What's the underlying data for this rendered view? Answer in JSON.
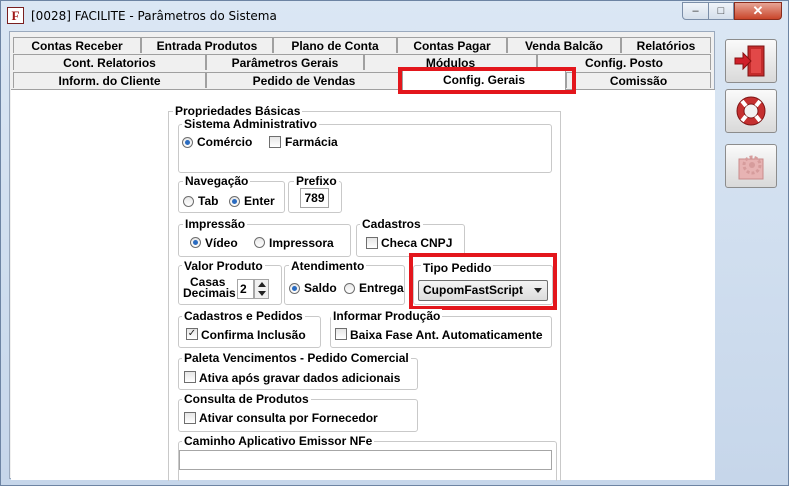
{
  "window": {
    "title": "[0028] FACILITE - Parâmetros do Sistema",
    "app_icon_letter": "F",
    "minimize": "–",
    "maximize": "□",
    "close": "✕"
  },
  "tabs": {
    "row1": [
      "Contas Receber",
      "Entrada Produtos",
      "Plano de Conta",
      "Contas Pagar",
      "Venda Balcão",
      "Relatórios"
    ],
    "row2": [
      "Cont. Relatorios",
      "Parâmetros Gerais",
      "Módulos",
      "Config. Posto"
    ],
    "row3": [
      "Inform. do Cliente",
      "Pedido de Vendas",
      "Config. Gerais",
      "Comissão"
    ],
    "active": "Config. Gerais"
  },
  "form": {
    "propriedades_basicas": "Propriedades Básicas",
    "sistema_administrativo": {
      "label": "Sistema Administrativo",
      "comercio": "Comércio",
      "farmacia": "Farmácia",
      "selected": "Comércio"
    },
    "navegacao": {
      "label": "Navegação",
      "tab": "Tab",
      "enter": "Enter",
      "selected": "Enter"
    },
    "prefixo": {
      "label": "Prefixo",
      "value": "789"
    },
    "impressao": {
      "label": "Impressão",
      "video": "Vídeo",
      "impressora": "Impressora",
      "selected": "Vídeo"
    },
    "cadastros": {
      "label": "Cadastros",
      "checa_cnpj": "Checa CNPJ",
      "checa_cnpj_checked": false
    },
    "valor_produto": {
      "label": "Valor Produto",
      "casas": "Casas",
      "decimais": "Decimais",
      "value": "2"
    },
    "atendimento": {
      "label": "Atendimento",
      "saldo": "Saldo",
      "entrega": "Entrega",
      "selected": "Saldo"
    },
    "tipo_pedido": {
      "label": "Tipo Pedido",
      "value": "CupomFastScript"
    },
    "cadastros_pedidos": {
      "label": "Cadastros e Pedidos",
      "confirma_inclusao": "Confirma Inclusão",
      "checked": true
    },
    "informar_producao": {
      "label": "Informar Produção",
      "baixa_fase": "Baixa Fase Ant. Automaticamente",
      "checked": false
    },
    "paleta_vencimentos": {
      "label": "Paleta Vencimentos - Pedido Comercial",
      "ativa_apos": "Ativa após gravar dados adicionais",
      "checked": false
    },
    "consulta_produtos": {
      "label": "Consulta de Produtos",
      "ativar_consulta": "Ativar consulta por Fornecedor",
      "checked": false
    },
    "caminho_nfe": {
      "label": "Caminho Aplicativo Emissor NFe",
      "value": ""
    }
  },
  "sidebar": {
    "icons": [
      "exit-door-icon",
      "lifebuoy-icon",
      "settings-gear-icon"
    ]
  },
  "colors": {
    "highlight": "#e3161c",
    "radio_dot": "#2a6bc0",
    "exit_arrow": "#d0202a"
  }
}
